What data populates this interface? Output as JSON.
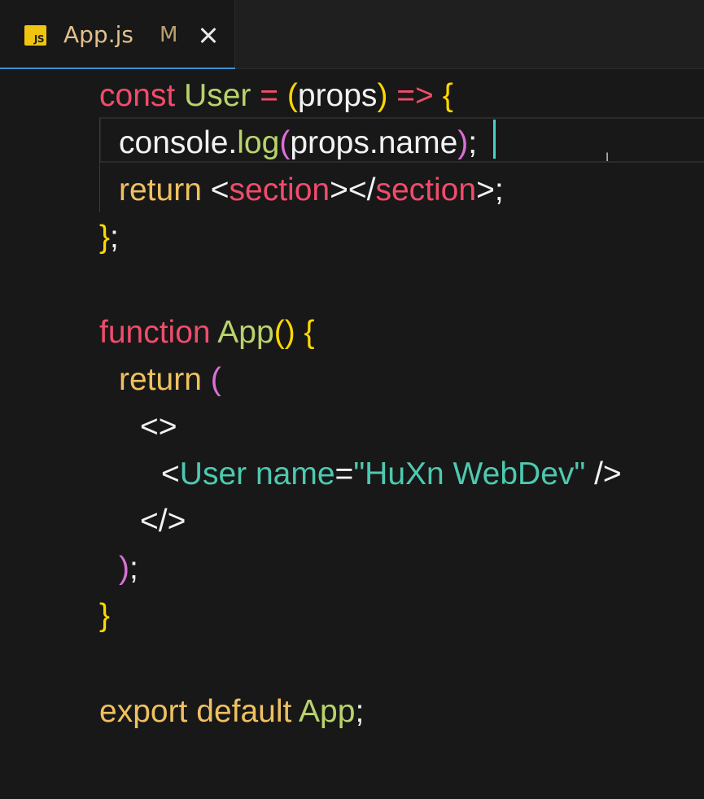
{
  "tab": {
    "icon_label": "JS",
    "title": "App.js",
    "status": "M"
  },
  "code": {
    "line1": {
      "kw": "const",
      "name": "User",
      "eq": "=",
      "paren_open": "(",
      "param": "props",
      "paren_close": ")",
      "arrow": "=>",
      "brace": "{"
    },
    "line2": {
      "obj": "console.",
      "method": "log",
      "paren_open": "(",
      "arg": "props.name",
      "paren_close": ")",
      "semi": ";"
    },
    "line3": {
      "kw": "return",
      "lt1": "<",
      "tag1": "section",
      "gt_lt": "></",
      "tag2": "section",
      "end": ">;"
    },
    "line4": {
      "brace": "}",
      "semi": ";"
    },
    "line6": {
      "kw": "function",
      "name": "App",
      "parens": "()",
      "brace": "{"
    },
    "line7": {
      "kw": "return",
      "paren": "("
    },
    "line8": {
      "fragment_open": "<>"
    },
    "line9": {
      "lt": "<",
      "comp": "User",
      "attr": "name",
      "eq": "=",
      "str": "\"HuXn WebDev\"",
      "close": "/>"
    },
    "line10": {
      "fragment_close": "</>"
    },
    "line11": {
      "paren": ")",
      "semi": ";"
    },
    "line12": {
      "brace": "}"
    },
    "line14": {
      "kw1": "export",
      "kw2": "default",
      "name": "App",
      "semi": ";"
    }
  }
}
